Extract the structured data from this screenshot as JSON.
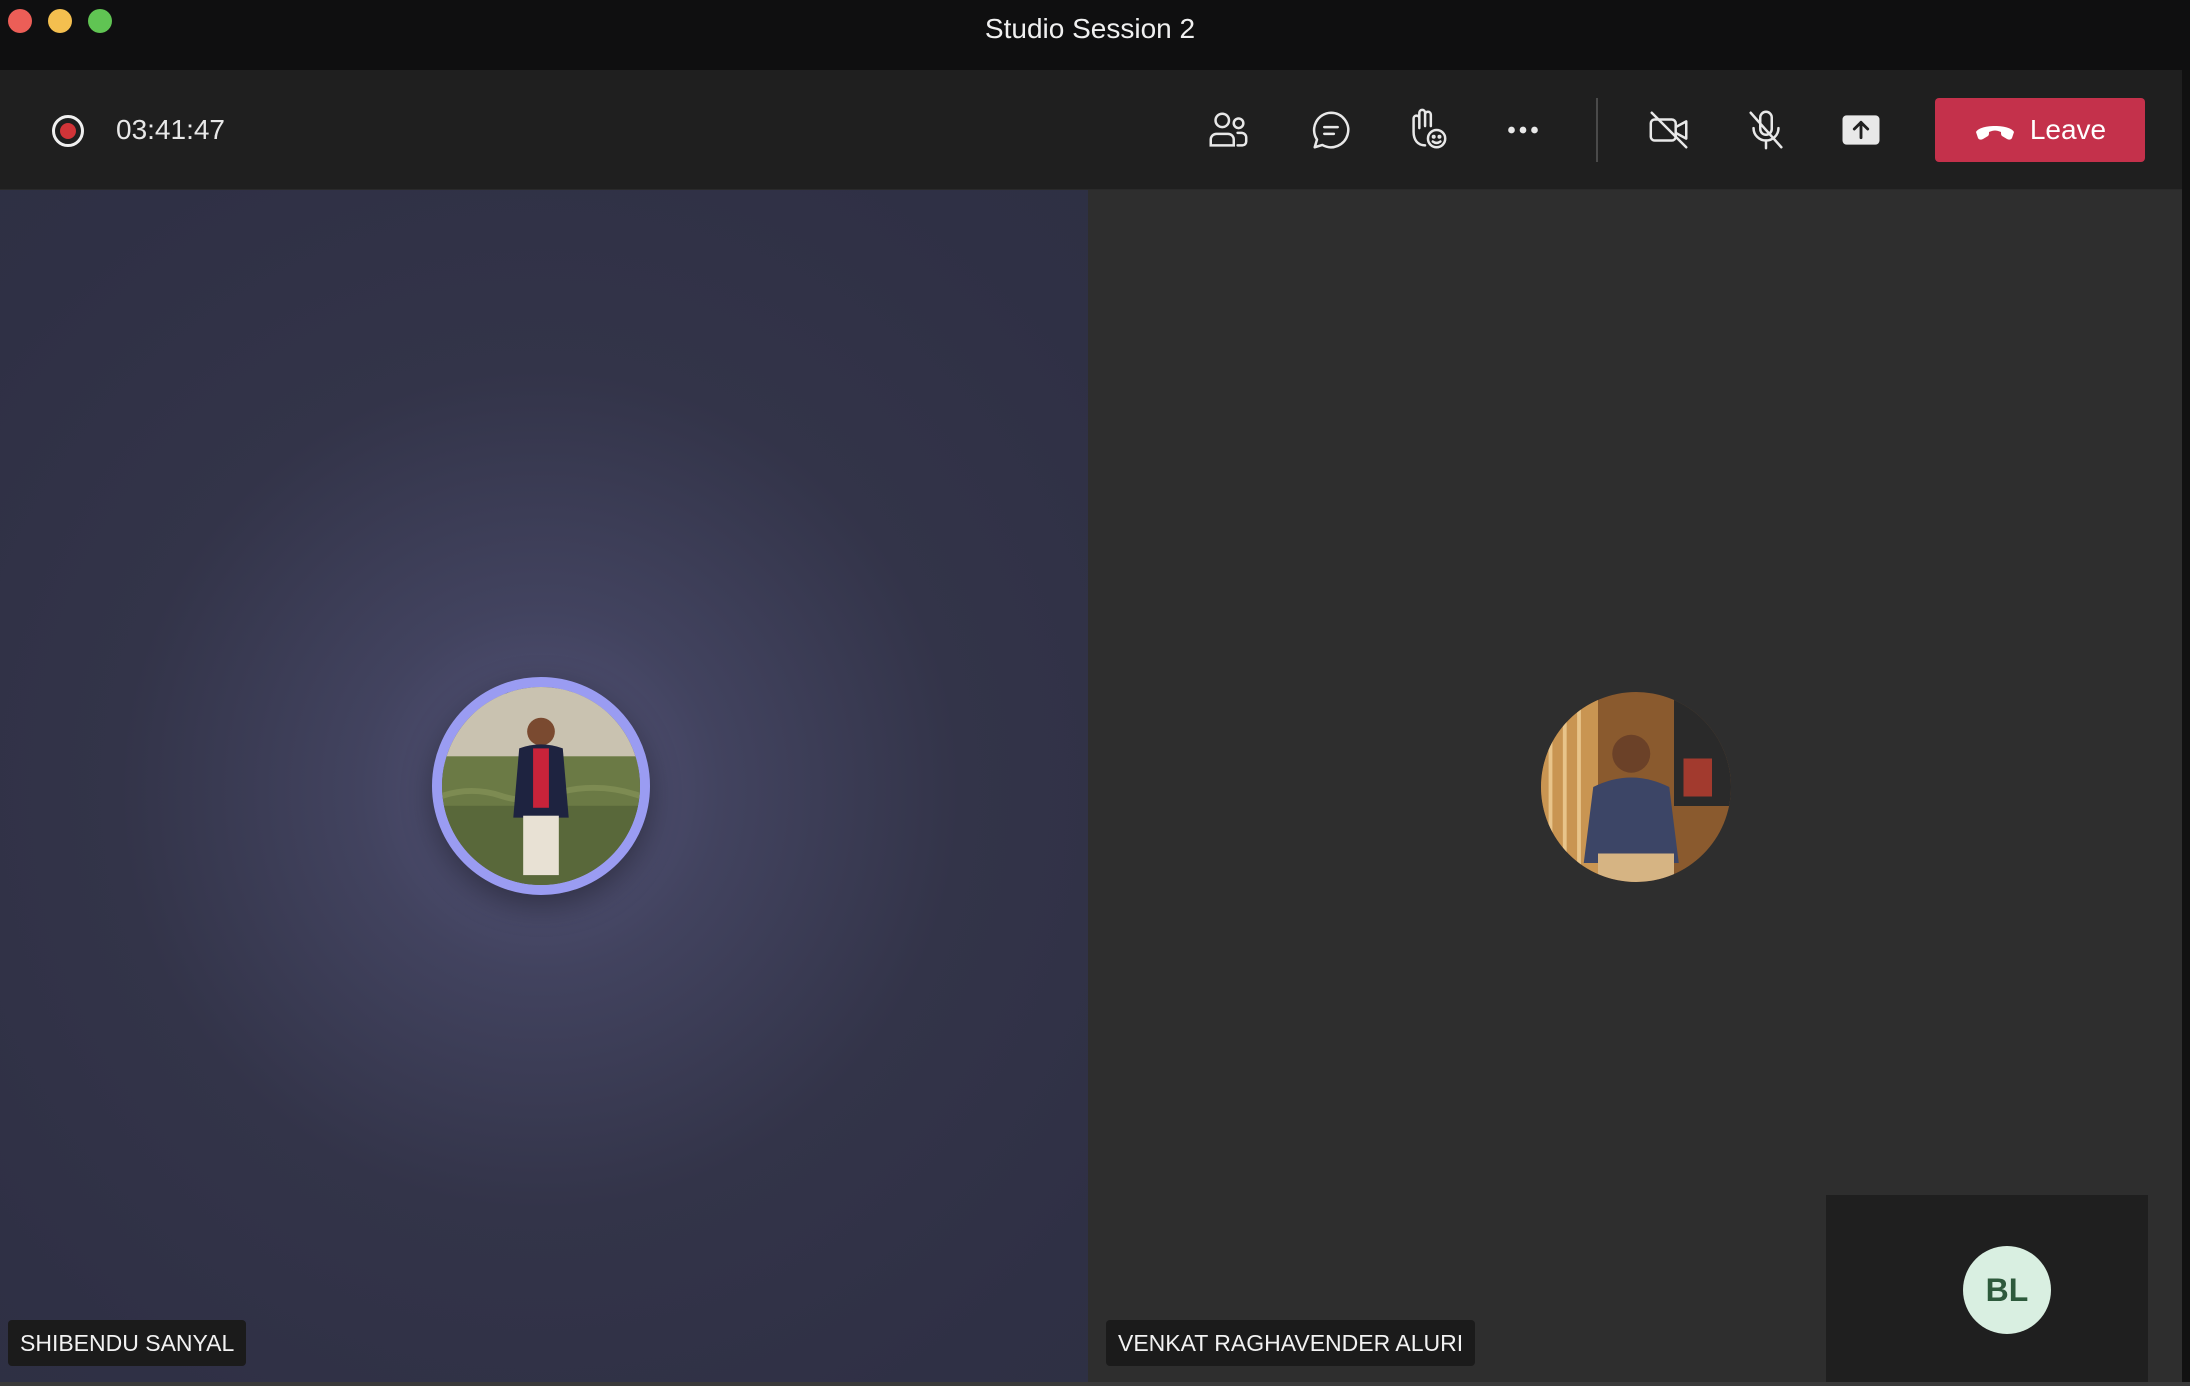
{
  "window": {
    "title": "Studio Session 2",
    "controls": [
      "close",
      "minimize",
      "maximize"
    ]
  },
  "toolbar": {
    "recording_icon": "record-icon",
    "timer": "03:41:47",
    "buttons": [
      {
        "name": "participants",
        "icon": "people-icon"
      },
      {
        "name": "chat",
        "icon": "chat-icon"
      },
      {
        "name": "reactions",
        "icon": "raise-hand-icon"
      },
      {
        "name": "more",
        "icon": "more-icon"
      },
      {
        "name": "camera",
        "icon": "camera-off-icon",
        "state": "off"
      },
      {
        "name": "mic",
        "icon": "mic-off-icon",
        "state": "muted"
      },
      {
        "name": "share",
        "icon": "share-screen-icon"
      }
    ],
    "leave_label": "Leave",
    "leave_icon": "phone-hangup-icon"
  },
  "participants": [
    {
      "name": "SHIBENDU SANYAL",
      "speaking": true,
      "avatar": "photo"
    },
    {
      "name": "VENKAT RAGHAVENDER ALURI",
      "speaking": false,
      "avatar": "photo"
    }
  ],
  "self_view": {
    "initials": "BL"
  },
  "colors": {
    "leave": "#c4314b",
    "speaking_ring": "#9a9cf2",
    "record": "#d13438",
    "self_avatar_bg": "#d9efe1",
    "self_avatar_text": "#2e5a3c"
  }
}
